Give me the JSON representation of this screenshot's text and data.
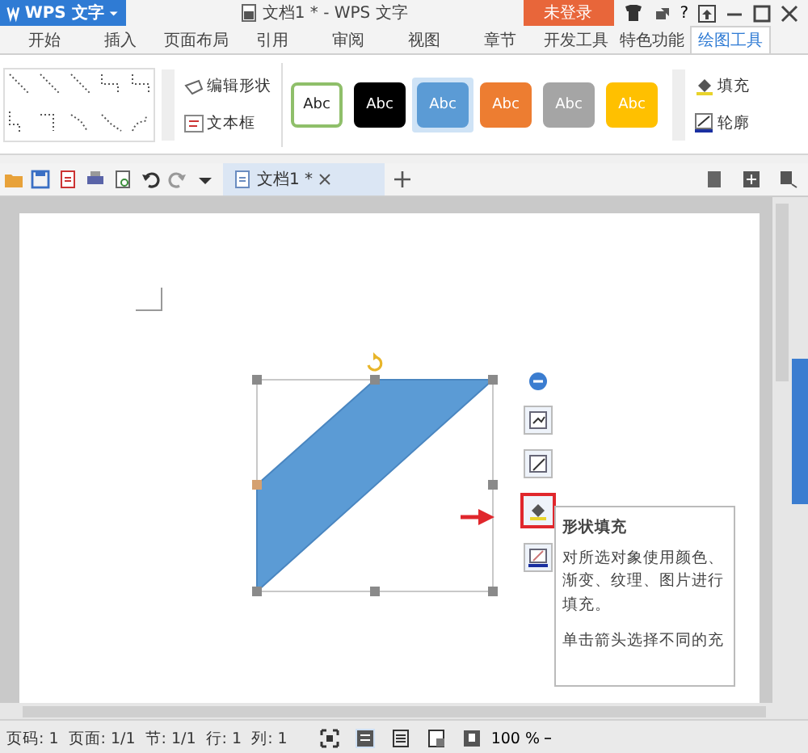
{
  "app_menu": {
    "label": "WPS 文字"
  },
  "window": {
    "title": "文档1 * - WPS 文字"
  },
  "login_button": {
    "label": "未登录"
  },
  "help": {
    "label": "?"
  },
  "tabs": [
    {
      "label": "开始",
      "selected": false
    },
    {
      "label": "插入",
      "selected": false
    },
    {
      "label": "页面布局",
      "selected": false
    },
    {
      "label": "引用",
      "selected": false
    },
    {
      "label": "审阅",
      "selected": false
    },
    {
      "label": "视图",
      "selected": false
    },
    {
      "label": "章节",
      "selected": false
    },
    {
      "label": "开发工具",
      "selected": false
    },
    {
      "label": "特色功能",
      "selected": false
    },
    {
      "label": "绘图工具",
      "selected": true
    }
  ],
  "ribbon": {
    "edit_shape": "编辑形状",
    "text_box": "文本框",
    "fill": "填充",
    "outline": "轮廓",
    "style_presets": [
      {
        "label": "Abc",
        "color": "#ffffff",
        "selected": false
      },
      {
        "label": "Abc",
        "color": "#000000",
        "selected": false
      },
      {
        "label": "Abc",
        "color": "#5b9bd5",
        "selected": true
      },
      {
        "label": "Abc",
        "color": "#ed7d31",
        "selected": false
      },
      {
        "label": "Abc",
        "color": "#a5a5a5",
        "selected": false
      },
      {
        "label": "Abc",
        "color": "#ffc000",
        "selected": false
      }
    ]
  },
  "doc_tabs": [
    {
      "label": "文档1 *",
      "selected": true
    }
  ],
  "tooltip": {
    "title": "形状填充",
    "body": "对所选对象使用颜色、渐变、纹理、图片进行填充。",
    "more": "单击箭头选择不同的充"
  },
  "status_bar": {
    "items": [
      "页码: 1",
      "页面: 1/1",
      "节: 1/1",
      "行: 1",
      "列: 1"
    ],
    "zoom": "100 %"
  }
}
